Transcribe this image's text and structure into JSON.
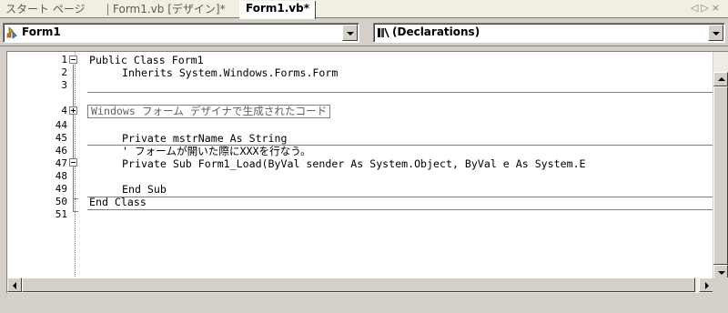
{
  "tabs": [
    {
      "label": "スタート ページ",
      "active": false
    },
    {
      "label": "Form1.vb [デザイン]*",
      "active": false
    },
    {
      "label": "Form1.vb*",
      "active": true
    }
  ],
  "tab_nav": {
    "left": "◁",
    "right": "▷",
    "close": "×"
  },
  "class_combo": {
    "value": "Form1",
    "icon": "class-icon"
  },
  "member_combo": {
    "value": "(Declarations)",
    "icon": "declarations-icon"
  },
  "code_lines": [
    {
      "num": "1",
      "text": "Public Class Form1"
    },
    {
      "num": "2",
      "text": "Inherits System.Windows.Forms.Form"
    },
    {
      "num": "3",
      "text": ""
    },
    {
      "num": "4",
      "text": "Windows フォーム デザイナで生成されたコード"
    },
    {
      "num": "44",
      "text": ""
    },
    {
      "num": "45",
      "text": "Private mstrName As String"
    },
    {
      "num": "46",
      "text": "' フォームが開いた際にXXXを行なう。"
    },
    {
      "num": "47",
      "text": "Private Sub Form1_Load(ByVal sender As System.Object, ByVal e As System.E"
    },
    {
      "num": "48",
      "text": ""
    },
    {
      "num": "49",
      "text": "End Sub"
    },
    {
      "num": "50",
      "text": "End Class"
    },
    {
      "num": "51",
      "text": ""
    }
  ],
  "colors": {
    "chrome": "#d4d0c8",
    "tabstrip": "#f1efe2",
    "editor_bg": "#ffffff",
    "region_text": "#606060"
  }
}
